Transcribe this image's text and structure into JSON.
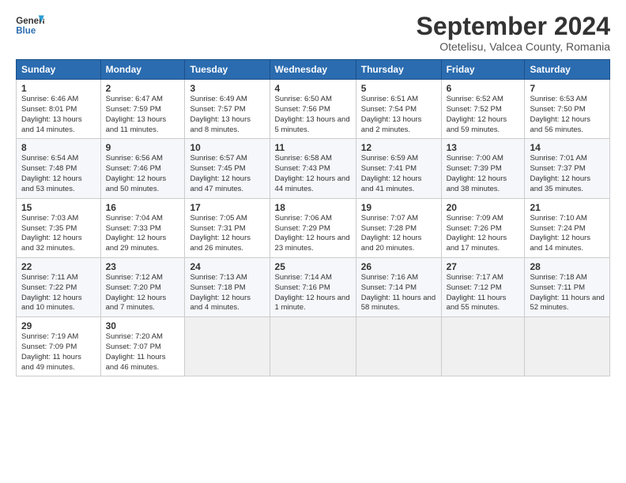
{
  "header": {
    "logo_line1": "General",
    "logo_line2": "Blue",
    "title": "September 2024",
    "subtitle": "Otetelisu, Valcea County, Romania"
  },
  "days_of_week": [
    "Sunday",
    "Monday",
    "Tuesday",
    "Wednesday",
    "Thursday",
    "Friday",
    "Saturday"
  ],
  "weeks": [
    [
      {
        "day": 1,
        "sunrise": "6:46 AM",
        "sunset": "8:01 PM",
        "daylight": "13 hours and 14 minutes."
      },
      {
        "day": 2,
        "sunrise": "6:47 AM",
        "sunset": "7:59 PM",
        "daylight": "13 hours and 11 minutes."
      },
      {
        "day": 3,
        "sunrise": "6:49 AM",
        "sunset": "7:57 PM",
        "daylight": "13 hours and 8 minutes."
      },
      {
        "day": 4,
        "sunrise": "6:50 AM",
        "sunset": "7:56 PM",
        "daylight": "13 hours and 5 minutes."
      },
      {
        "day": 5,
        "sunrise": "6:51 AM",
        "sunset": "7:54 PM",
        "daylight": "13 hours and 2 minutes."
      },
      {
        "day": 6,
        "sunrise": "6:52 AM",
        "sunset": "7:52 PM",
        "daylight": "12 hours and 59 minutes."
      },
      {
        "day": 7,
        "sunrise": "6:53 AM",
        "sunset": "7:50 PM",
        "daylight": "12 hours and 56 minutes."
      }
    ],
    [
      {
        "day": 8,
        "sunrise": "6:54 AM",
        "sunset": "7:48 PM",
        "daylight": "12 hours and 53 minutes."
      },
      {
        "day": 9,
        "sunrise": "6:56 AM",
        "sunset": "7:46 PM",
        "daylight": "12 hours and 50 minutes."
      },
      {
        "day": 10,
        "sunrise": "6:57 AM",
        "sunset": "7:45 PM",
        "daylight": "12 hours and 47 minutes."
      },
      {
        "day": 11,
        "sunrise": "6:58 AM",
        "sunset": "7:43 PM",
        "daylight": "12 hours and 44 minutes."
      },
      {
        "day": 12,
        "sunrise": "6:59 AM",
        "sunset": "7:41 PM",
        "daylight": "12 hours and 41 minutes."
      },
      {
        "day": 13,
        "sunrise": "7:00 AM",
        "sunset": "7:39 PM",
        "daylight": "12 hours and 38 minutes."
      },
      {
        "day": 14,
        "sunrise": "7:01 AM",
        "sunset": "7:37 PM",
        "daylight": "12 hours and 35 minutes."
      }
    ],
    [
      {
        "day": 15,
        "sunrise": "7:03 AM",
        "sunset": "7:35 PM",
        "daylight": "12 hours and 32 minutes."
      },
      {
        "day": 16,
        "sunrise": "7:04 AM",
        "sunset": "7:33 PM",
        "daylight": "12 hours and 29 minutes."
      },
      {
        "day": 17,
        "sunrise": "7:05 AM",
        "sunset": "7:31 PM",
        "daylight": "12 hours and 26 minutes."
      },
      {
        "day": 18,
        "sunrise": "7:06 AM",
        "sunset": "7:29 PM",
        "daylight": "12 hours and 23 minutes."
      },
      {
        "day": 19,
        "sunrise": "7:07 AM",
        "sunset": "7:28 PM",
        "daylight": "12 hours and 20 minutes."
      },
      {
        "day": 20,
        "sunrise": "7:09 AM",
        "sunset": "7:26 PM",
        "daylight": "12 hours and 17 minutes."
      },
      {
        "day": 21,
        "sunrise": "7:10 AM",
        "sunset": "7:24 PM",
        "daylight": "12 hours and 14 minutes."
      }
    ],
    [
      {
        "day": 22,
        "sunrise": "7:11 AM",
        "sunset": "7:22 PM",
        "daylight": "12 hours and 10 minutes."
      },
      {
        "day": 23,
        "sunrise": "7:12 AM",
        "sunset": "7:20 PM",
        "daylight": "12 hours and 7 minutes."
      },
      {
        "day": 24,
        "sunrise": "7:13 AM",
        "sunset": "7:18 PM",
        "daylight": "12 hours and 4 minutes."
      },
      {
        "day": 25,
        "sunrise": "7:14 AM",
        "sunset": "7:16 PM",
        "daylight": "12 hours and 1 minute."
      },
      {
        "day": 26,
        "sunrise": "7:16 AM",
        "sunset": "7:14 PM",
        "daylight": "11 hours and 58 minutes."
      },
      {
        "day": 27,
        "sunrise": "7:17 AM",
        "sunset": "7:12 PM",
        "daylight": "11 hours and 55 minutes."
      },
      {
        "day": 28,
        "sunrise": "7:18 AM",
        "sunset": "7:11 PM",
        "daylight": "11 hours and 52 minutes."
      }
    ],
    [
      {
        "day": 29,
        "sunrise": "7:19 AM",
        "sunset": "7:09 PM",
        "daylight": "11 hours and 49 minutes."
      },
      {
        "day": 30,
        "sunrise": "7:20 AM",
        "sunset": "7:07 PM",
        "daylight": "11 hours and 46 minutes."
      },
      null,
      null,
      null,
      null,
      null
    ]
  ]
}
